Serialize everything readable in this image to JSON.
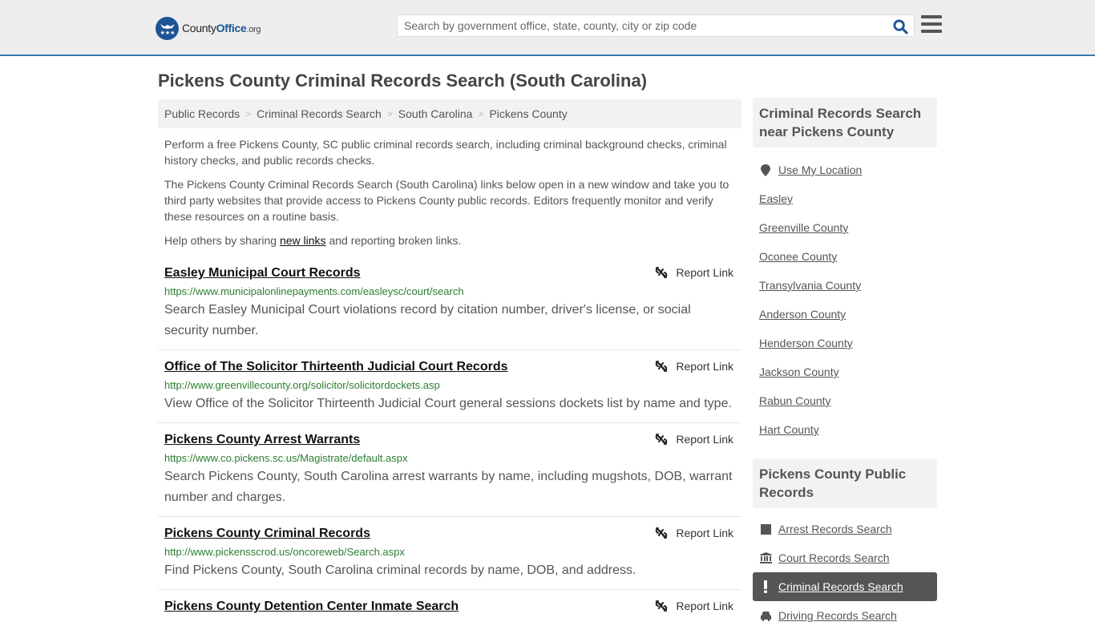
{
  "header": {
    "logo": {
      "name": "County",
      "office": "Office",
      "tld": ".org"
    },
    "search_placeholder": "Search by government office, state, county, city or zip code",
    "search_value": ""
  },
  "page_title": "Pickens County Criminal Records Search (South Carolina)",
  "breadcrumb": [
    "Public Records",
    "Criminal Records Search",
    "South Carolina",
    "Pickens County"
  ],
  "intro": {
    "p1": "Perform a free Pickens County, SC public criminal records search, including criminal background checks, criminal history checks, and public records checks.",
    "p2": "The Pickens County Criminal Records Search (South Carolina) links below open in a new window and take you to third party websites that provide access to Pickens County public records. Editors frequently monitor and verify these resources on a routine basis.",
    "p3_before": "Help others by sharing ",
    "p3_link": "new links",
    "p3_after": " and reporting broken links."
  },
  "report_label": "Report Link",
  "results": [
    {
      "title": "Easley Municipal Court Records",
      "url": "https://www.municipalonlinepayments.com/easleysc/court/search",
      "desc": "Search Easley Municipal Court violations record by citation number, driver's license, or social security number."
    },
    {
      "title": "Office of The Solicitor Thirteenth Judicial Court Records",
      "url": "http://www.greenvillecounty.org/solicitor/solicitordockets.asp",
      "desc": "View Office of the Solicitor Thirteenth Judicial Court general sessions dockets list by name and type."
    },
    {
      "title": "Pickens County Arrest Warrants",
      "url": "https://www.co.pickens.sc.us/Magistrate/default.aspx",
      "desc": "Search Pickens County, South Carolina arrest warrants by name, including mugshots, DOB, warrant number and charges."
    },
    {
      "title": "Pickens County Criminal Records",
      "url": "http://www.pickensscrod.us/oncoreweb/Search.aspx",
      "desc": "Find Pickens County, South Carolina criminal records by name, DOB, and address."
    },
    {
      "title": "Pickens County Detention Center Inmate Search",
      "url": "",
      "desc": ""
    }
  ],
  "sidebar": {
    "nearby_heading": "Criminal Records Search near Pickens County",
    "use_location": "Use My Location",
    "nearby": [
      "Easley",
      "Greenville County",
      "Oconee County",
      "Transylvania County",
      "Anderson County",
      "Henderson County",
      "Jackson County",
      "Rabun County",
      "Hart County"
    ],
    "public_heading": "Pickens County Public Records",
    "public_items": [
      {
        "label": "Arrest Records Search",
        "icon": "square-icon"
      },
      {
        "label": "Court Records Search",
        "icon": "courthouse-icon"
      },
      {
        "label": "Criminal Records Search",
        "icon": "exclamation-icon",
        "active": true
      },
      {
        "label": "Driving Records Search",
        "icon": "car-icon"
      }
    ]
  },
  "colors": {
    "brand_blue": "#1d5496",
    "accent_bar": "#3a7bb0",
    "url_green": "#2e7d32",
    "active_bg": "#555555"
  }
}
